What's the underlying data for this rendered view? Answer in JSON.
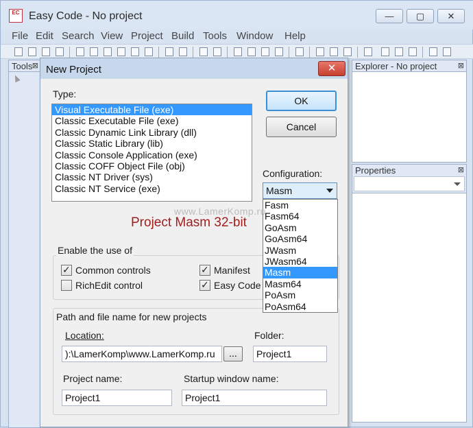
{
  "app": {
    "title": "Easy Code - No project",
    "logo_text": "EC"
  },
  "window_controls": {
    "minimize": "—",
    "maximize": "▢",
    "close": "✕"
  },
  "menu": [
    "File",
    "Edit",
    "Search",
    "View",
    "Project",
    "Build",
    "Tools",
    "Window",
    "Help"
  ],
  "panels": {
    "tools_title": "Tools",
    "explorer_title": "Explorer - No project",
    "properties_title": "Properties",
    "close_glyph": "⊠"
  },
  "dialog": {
    "title": "New Project",
    "close_glyph": "✕",
    "type_label": "Type:",
    "types": [
      "Visual Executable File (exe)",
      "Classic Executable File (exe)",
      "Classic Dynamic Link Library (dll)",
      "Classic Static Library (lib)",
      "Classic Console Application (exe)",
      "Classic COFF Object File (obj)",
      "Classic NT Driver (sys)",
      "Classic NT Service (exe)"
    ],
    "selected_type_index": 0,
    "ok_label": "OK",
    "cancel_label": "Cancel",
    "configuration_label": "Configuration:",
    "configuration_value": "Masm",
    "configuration_options": [
      "Fasm",
      "Fasm64",
      "GoAsm",
      "GoAsm64",
      "JWasm",
      "JWasm64",
      "Masm",
      "Masm64",
      "PoAsm",
      "PoAsm64"
    ],
    "selected_option_index": 6,
    "project_caption": "Project Masm 32-bit",
    "enable_group_label": "Enable the use of",
    "checkboxes": {
      "common_controls": {
        "label": "Common controls",
        "checked": true
      },
      "richedit_control": {
        "label": "RichEdit control",
        "checked": false
      },
      "manifest": {
        "label": "Manifest",
        "checked": true
      },
      "easy_code": {
        "label": "Easy Code r",
        "checked": true
      }
    },
    "path_group_label": "Path and file name for new projects",
    "location_label": "Location:",
    "location_value": "):\\LamerKomp\\www.LamerKomp.ru",
    "browse_label": "...",
    "folder_label": "Folder:",
    "folder_value": "Project1",
    "project_name_label": "Project name:",
    "project_name_value": "Project1",
    "startup_window_label": "Startup window name:",
    "startup_window_value": "Project1"
  },
  "watermark": "www.LamerKomp.ru"
}
